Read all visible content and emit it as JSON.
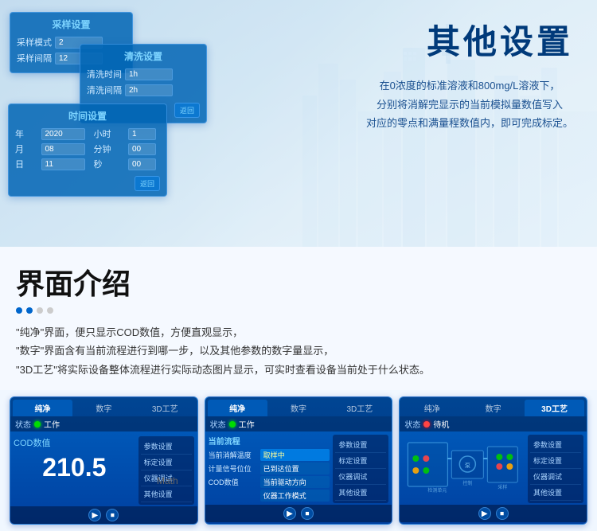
{
  "top": {
    "right_title": "其他设置",
    "right_desc_line1": "在0浓度的标准溶液和800mg/L溶液下，",
    "right_desc_line2": "分别将消解完显示的当前模拟量数值写入",
    "right_desc_line3": "对应的零点和满量程数值内，即可完成标定。"
  },
  "dialogs": {
    "sample": {
      "title": "采样设置",
      "row1_label": "采样模式",
      "row1_value": "2",
      "row2_label": "采样间隔",
      "row2_value": "12"
    },
    "clean": {
      "title": "清洗设置",
      "row1_label": "清洗时间",
      "row1_value": "1h",
      "row2_label": "清洗间隔",
      "row2_value": "2h",
      "back": "返回"
    },
    "time": {
      "title": "时间设置",
      "year_label": "年",
      "year_value": "2020",
      "hour_label": "小时",
      "hour_value": "1",
      "month_label": "月",
      "month_value": "08",
      "min_label": "分钟",
      "min_value": "00",
      "day_label": "日",
      "day_value": "11",
      "sec_label": "秒",
      "sec_value": "00",
      "back": "返回"
    }
  },
  "middle": {
    "title": "界面介绍",
    "text_line1": "\"纯净\"界面，便只显示COD数值，方便直观显示，",
    "text_line2": "\"数字\"界面含有当前流程进行到哪一步，以及其他参数的数字量显示，",
    "text_line3": "\"3D工艺\"将实际设备整体流程进行实际动态图片显示，可实时查看设备当前处于什么状态。"
  },
  "panels": {
    "tabs": [
      "纯净",
      "数字",
      "3D工艺"
    ],
    "status_label": "状态",
    "status_work": "工作",
    "status_standby": "待机",
    "panel1": {
      "tab_active": "纯净",
      "status": "工作",
      "cod_label": "COD数值",
      "cod_value": "210.5",
      "nav": [
        "参数设置",
        "标定设置",
        "仪器调试",
        "其他设置"
      ]
    },
    "panel2": {
      "tab_active": "纯净",
      "status": "工作",
      "process_label": "当前流程",
      "rows": [
        {
          "label": "当前消解温度",
          "value": "取样中",
          "highlight": true
        },
        {
          "label": "计量信号位位",
          "value": "已到达位置",
          "highlight": false
        },
        {
          "label": "COD数值",
          "value": "当前驱动方向",
          "highlight": false
        },
        {
          "label": "",
          "value": "仪器工作模式",
          "highlight": false
        }
      ],
      "nav": [
        "参数设置",
        "标定设置",
        "仪器调试",
        "其他设置"
      ]
    },
    "panel3": {
      "tab_active": "3D工艺",
      "status": "待机",
      "nav": [
        "参数设置",
        "标定设置",
        "仪器调试",
        "其他设置"
      ]
    }
  },
  "math_label": "Math"
}
